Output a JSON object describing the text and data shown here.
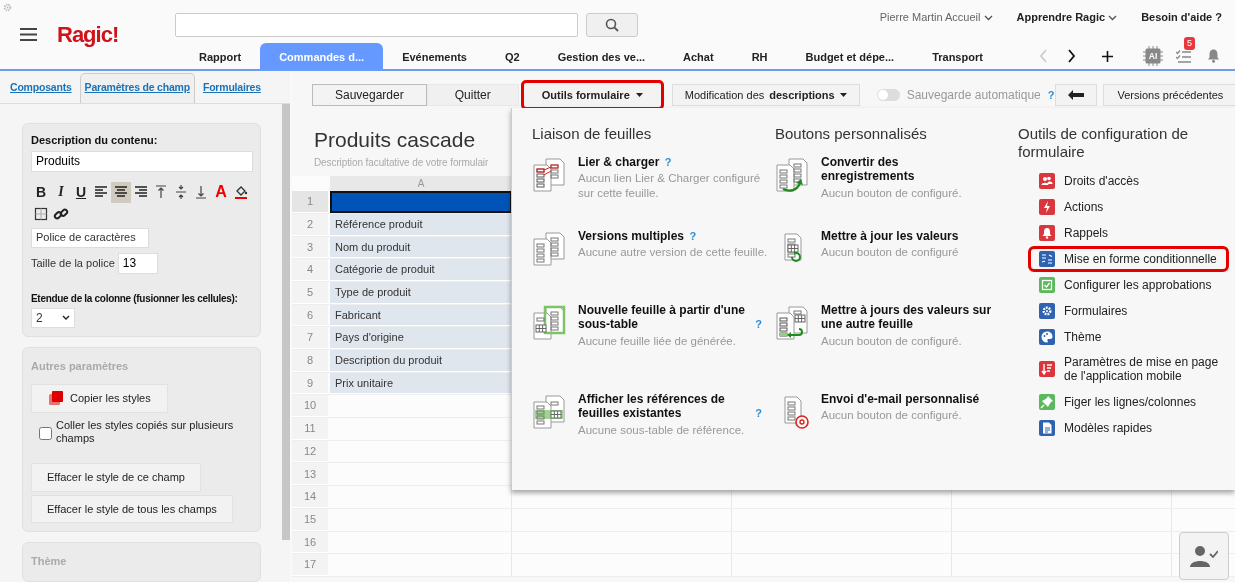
{
  "header": {
    "logo": "Ragic!",
    "account_links": [
      {
        "label": "Pierre Martin Accueil",
        "kind": "account"
      },
      {
        "label": "Apprendre Ragic",
        "kind": "menu"
      },
      {
        "label": "Besoin d'aide ?",
        "kind": "link"
      }
    ],
    "tabs": [
      {
        "label": "Rapport",
        "selected": false
      },
      {
        "label": "Commandes d...",
        "selected": true
      },
      {
        "label": "Evénements",
        "selected": false
      },
      {
        "label": "Q2",
        "selected": false
      },
      {
        "label": "Gestion des ve...",
        "selected": false
      },
      {
        "label": "Achat",
        "selected": false
      },
      {
        "label": "RH",
        "selected": false
      },
      {
        "label": "Budget et dépe...",
        "selected": false
      },
      {
        "label": "Transport",
        "selected": false
      }
    ],
    "tab_arrows": [
      {
        "kind": "previous",
        "disabled": true
      },
      {
        "kind": "next",
        "disabled": false
      }
    ],
    "chip_label": "AI",
    "task_badge": "5"
  },
  "left_panel": {
    "tabs": [
      {
        "label": "Composants",
        "selected": false
      },
      {
        "label": "Paramètres de champ",
        "selected": true
      },
      {
        "label": "Formulaires",
        "selected": false
      }
    ],
    "content_label": "Description du contenu:",
    "content_value": "Produits",
    "format_tools": [
      {
        "kind": "bold",
        "glyph": "B",
        "selected": false
      },
      {
        "kind": "italic",
        "glyph": "I",
        "selected": false
      },
      {
        "kind": "underline",
        "glyph": "U",
        "selected": false
      },
      {
        "kind": "align-left",
        "selected": false
      },
      {
        "kind": "align-center",
        "selected": true
      },
      {
        "kind": "align-right",
        "selected": false
      },
      {
        "kind": "valign-top",
        "selected": false
      },
      {
        "kind": "valign-middle",
        "selected": false
      },
      {
        "kind": "valign-bottom",
        "selected": false
      },
      {
        "kind": "font-color",
        "glyph": "A",
        "selected": false
      },
      {
        "kind": "fill-color",
        "selected": false
      },
      {
        "kind": "border",
        "selected": false
      },
      {
        "kind": "link",
        "selected": false
      }
    ],
    "font_select": "Police de caractères",
    "font_size_label": "Taille de la police",
    "font_size": "13",
    "colspan_label": "Etendue de la colonne (fusionner les cellules):",
    "colspan": "2",
    "other_title": "Autres paramètres",
    "copy_button": "Copier les styles",
    "paste_option": {
      "label": "Coller les styles copiés sur plusieurs champs",
      "checked": false
    },
    "clear_buttons": [
      "Effacer le style de ce champ",
      "Effacer le style de tous les champs"
    ],
    "theme_title": "Thème"
  },
  "toolbar": {
    "save": "Sauvegarder",
    "quit": "Quitter",
    "form_tools": {
      "label": "Outils formulaire",
      "highlighted": true,
      "expanded": true
    },
    "descriptions": "Modification des **descriptions**",
    "autosave": {
      "label": "Sauvegarde automatique",
      "on": false,
      "help": "?"
    },
    "versions": "Versions précédentes"
  },
  "form": {
    "title": "Produits cascade",
    "description": "Description facultative de votre formulair",
    "column": "A",
    "rows": [
      {
        "number": "1",
        "selected": true
      },
      {
        "number": "2",
        "text": "Référence produit",
        "selected": false
      },
      {
        "number": "3",
        "text": "Nom du produit",
        "selected": false
      },
      {
        "number": "4",
        "text": "Catégorie de produit",
        "selected": false
      },
      {
        "number": "5",
        "text": "Type de produit",
        "selected": false
      },
      {
        "number": "6",
        "text": "Fabricant",
        "selected": false
      },
      {
        "number": "7",
        "text": "Pays d'origine",
        "selected": false
      },
      {
        "number": "8",
        "text": "Description du produit",
        "selected": false
      },
      {
        "number": "9",
        "text": "Prix unitaire",
        "selected": false
      },
      {
        "number": "10",
        "selected": false
      },
      {
        "number": "11",
        "selected": false
      },
      {
        "number": "12",
        "selected": false
      },
      {
        "number": "13",
        "selected": false
      },
      {
        "number": "14",
        "selected": false
      },
      {
        "number": "15",
        "selected": false
      },
      {
        "number": "16",
        "selected": false
      },
      {
        "number": "17",
        "selected": false
      }
    ]
  },
  "menu": {
    "sections": [
      {
        "title": "Liaison de feuilles",
        "items": [
          {
            "kind": "link",
            "title": "Lier & charger",
            "help": "?",
            "description": "Aucun lien Lier & Charger configuré sur cette feuille."
          },
          {
            "kind": "versions",
            "title": "Versions multiples",
            "help": "?",
            "description": "Aucune autre version de cette feuille."
          },
          {
            "kind": "subtable",
            "title": "Nouvelle feuille à partir d'une sous-table",
            "help": "?",
            "description": "Aucune feuille liée de générée."
          },
          {
            "kind": "references",
            "title": "Afficher les références de feuilles existantes",
            "help": "?",
            "description": "Aucune sous-table de référence."
          }
        ]
      },
      {
        "title": "Boutons personnalisés",
        "items": [
          {
            "kind": "convert",
            "title": "Convertir des enregistrements",
            "description": "Aucun bouton de configuré."
          },
          {
            "kind": "update",
            "title": "Mettre à jour les valeurs",
            "description": "Aucun bouton de configuré"
          },
          {
            "kind": "update-other",
            "title": "Mettre à jours des valeurs sur une autre feuille",
            "description": "Aucun bouton de configuré."
          },
          {
            "kind": "email",
            "title": "Envoi d'e-mail personnalisé",
            "description": "Aucun bouton de configuré."
          }
        ]
      }
    ],
    "config": {
      "title": "Outils de configuration de formulaire",
      "items": [
        {
          "kind": "access",
          "label": "Droits d'accès",
          "color": "#d9363e",
          "highlighted": false
        },
        {
          "kind": "actions",
          "label": "Actions",
          "color": "#d9363e",
          "highlighted": false
        },
        {
          "kind": "reminders",
          "label": "Rappels",
          "color": "#d9363e",
          "highlighted": false
        },
        {
          "kind": "conditional",
          "label": "Mise en forme conditionnelle",
          "color": "#2f63b0",
          "highlighted": true
        },
        {
          "kind": "approvals",
          "label": "Configurer les approbations",
          "color": "#5cb85c",
          "highlighted": false
        },
        {
          "kind": "forms",
          "label": "Formulaires",
          "color": "#2f63b0",
          "highlighted": false
        },
        {
          "kind": "theme",
          "label": "Thème",
          "color": "#2f63b0",
          "highlighted": false
        },
        {
          "kind": "mobile",
          "label": "Paramètres de mise en page de l'application mobile",
          "color": "#d9363e",
          "highlighted": false
        },
        {
          "kind": "freeze",
          "label": "Figer les lignes/colonnes",
          "color": "#5cb85c",
          "highlighted": false
        },
        {
          "kind": "templates",
          "label": "Modèles rapides",
          "color": "#2f63b0",
          "highlighted": false
        }
      ]
    }
  }
}
